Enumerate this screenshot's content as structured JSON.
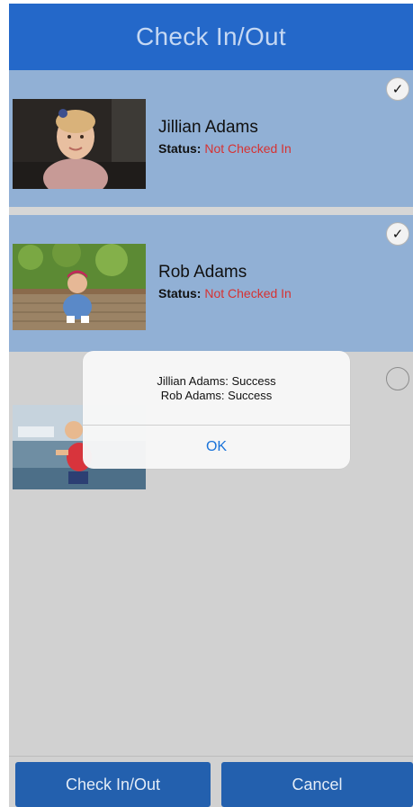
{
  "header": {
    "title": "Check In/Out"
  },
  "people": [
    {
      "name": "Jillian Adams",
      "status_label": "Status:",
      "status_value": "Not Checked In",
      "selected": true,
      "check_icon": "checkmark-icon"
    },
    {
      "name": "Rob Adams",
      "status_label": "Status:",
      "status_value": "Not Checked In",
      "selected": true,
      "check_icon": "checkmark-icon"
    },
    {
      "name": "",
      "status_label": "",
      "status_value": "",
      "selected": false,
      "check_icon": "empty-circle-icon"
    }
  ],
  "alert": {
    "lines": [
      "Jillian Adams: Success",
      "Rob Adams: Success"
    ],
    "ok_label": "OK"
  },
  "footer": {
    "check_in_out_label": "Check In/Out",
    "cancel_label": "Cancel"
  },
  "colors": {
    "header": "#2468c9",
    "selected_row": "#91b0d5",
    "status_not_checked_in": "#d63232",
    "button": "#2360ae",
    "alert_link": "#1a73d9"
  }
}
